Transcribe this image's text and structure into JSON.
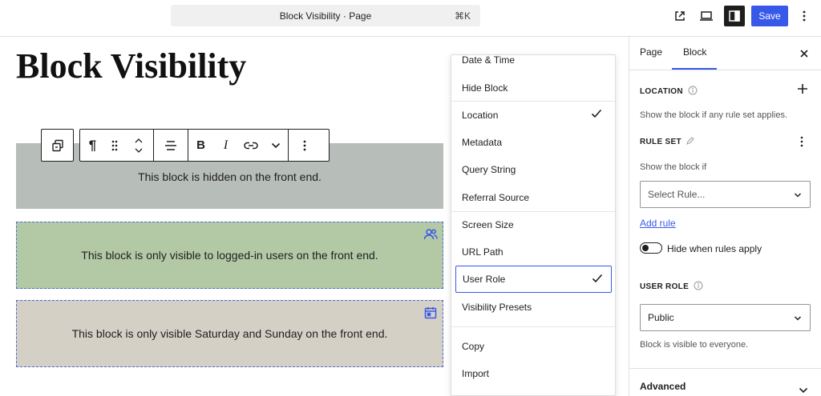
{
  "topbar": {
    "command_title": "Block Visibility · Page",
    "command_shortcut": "⌘K",
    "save_label": "Save",
    "icons": [
      "external-link-icon",
      "desktop-preview-icon",
      "sidebar-toggle-icon",
      "more-vertical-icon"
    ]
  },
  "editor": {
    "page_title": "Block Visibility",
    "blocks": [
      {
        "text": "This block is hidden on the front end.",
        "color": "#b7bdb9"
      },
      {
        "text": "This block is only visible to logged-in users on the front end.",
        "color": "#b3c9a5",
        "icon": "users-icon"
      },
      {
        "text": "This block is only visible Saturday and Sunday on the front end.",
        "color": "#d5d0c6",
        "icon": "calendar-icon"
      }
    ],
    "toolbar_icons": [
      "block-transform-icon",
      "paragraph-icon",
      "drag-handle-icon",
      "move-arrows-icon",
      "align-icon",
      "bold-icon",
      "italic-icon",
      "link-icon",
      "chevron-down-icon",
      "more-options-icon"
    ]
  },
  "menu": {
    "items": [
      {
        "label": "Date & Time",
        "checked": false
      },
      {
        "label": "Hide Block",
        "checked": false
      },
      {
        "label": "Location",
        "checked": true
      },
      {
        "label": "Metadata",
        "checked": false
      },
      {
        "label": "Query String",
        "checked": false
      },
      {
        "label": "Referral Source",
        "checked": false
      },
      {
        "label": "Screen Size",
        "checked": false
      },
      {
        "label": "URL Path",
        "checked": false
      },
      {
        "label": "User Role",
        "checked": true,
        "selected": true
      },
      {
        "label": "Visibility Presets",
        "checked": false
      }
    ],
    "actions": [
      "Copy",
      "Import"
    ]
  },
  "sidebar": {
    "tabs": [
      "Page",
      "Block"
    ],
    "active_tab": "Block",
    "location_label": "LOCATION",
    "location_help": "Show the block if any rule set applies.",
    "ruleset_label": "RULE SET",
    "ruleset_help": "Show the block if",
    "select_rule_placeholder": "Select Rule...",
    "add_rule": "Add rule",
    "hide_toggle_label": "Hide when rules apply",
    "hide_toggle_on": false,
    "user_role_label": "USER ROLE",
    "user_role_value": "Public",
    "user_role_help": "Block is visible to everyone.",
    "advanced_label": "Advanced"
  },
  "colors": {
    "accent": "#3858e9",
    "dark": "#1e1e1e"
  }
}
